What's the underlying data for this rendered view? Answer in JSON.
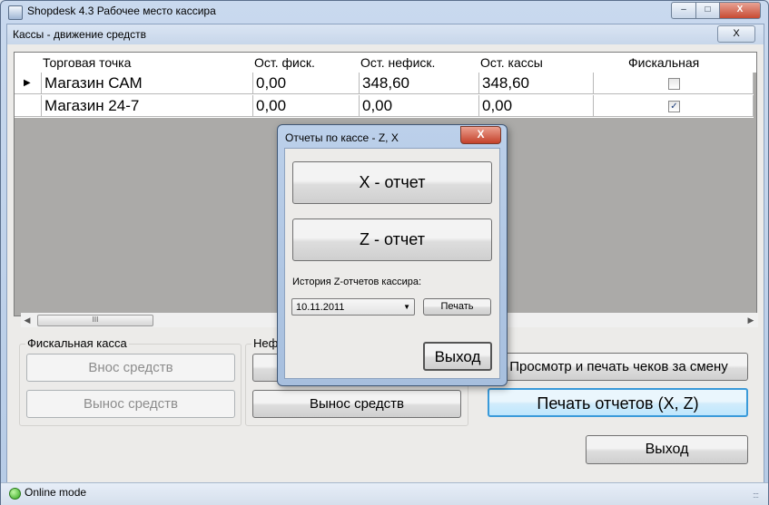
{
  "window": {
    "title": "Shopdesk 4.3 Рабочее место кассира",
    "min_glyph": "‒",
    "max_glyph": "□",
    "close_glyph": "X"
  },
  "child": {
    "title": "Кассы - движение средств",
    "close_glyph": "X"
  },
  "grid": {
    "columns": [
      "Торговая точка",
      "Ост. фиск.",
      "Ост. нефиск.",
      "Ост. кассы",
      "Фискальная"
    ],
    "rows": [
      {
        "point": "Магазин САМ",
        "fisc": "0,00",
        "nonfisc": "348,60",
        "cash": "348,60",
        "fiscal": false,
        "current": true
      },
      {
        "point": "Магазин 24-7",
        "fisc": "0,00",
        "nonfisc": "0,00",
        "cash": "0,00",
        "fiscal": true,
        "current": false
      }
    ],
    "current_marker": "▶",
    "scroll_left": "◀",
    "scroll_right": "▶",
    "scroll_grip": "III"
  },
  "fiscal_group": {
    "label": "Фискальная касса",
    "deposit": "Внос средств",
    "withdraw": "Вынос средств"
  },
  "nonfiscal_group": {
    "label": "Неф",
    "withdraw": "Вынос средств"
  },
  "actions": {
    "view_receipts": "Просмотр и печать чеков за смену",
    "print_reports": "Печать отчетов (X, Z)",
    "exit": "Выход"
  },
  "status": {
    "mode": "Online mode",
    "grip": "::::"
  },
  "dialog": {
    "title": "Отчеты по кассе - Z, X",
    "close_glyph": "X",
    "x_report": "X - отчет",
    "z_report": "Z - отчет",
    "history_label": "История Z-отчетов кассира:",
    "date_value": "10.11.2011",
    "date_arrow": "▼",
    "print": "Печать",
    "exit": "Выход"
  }
}
